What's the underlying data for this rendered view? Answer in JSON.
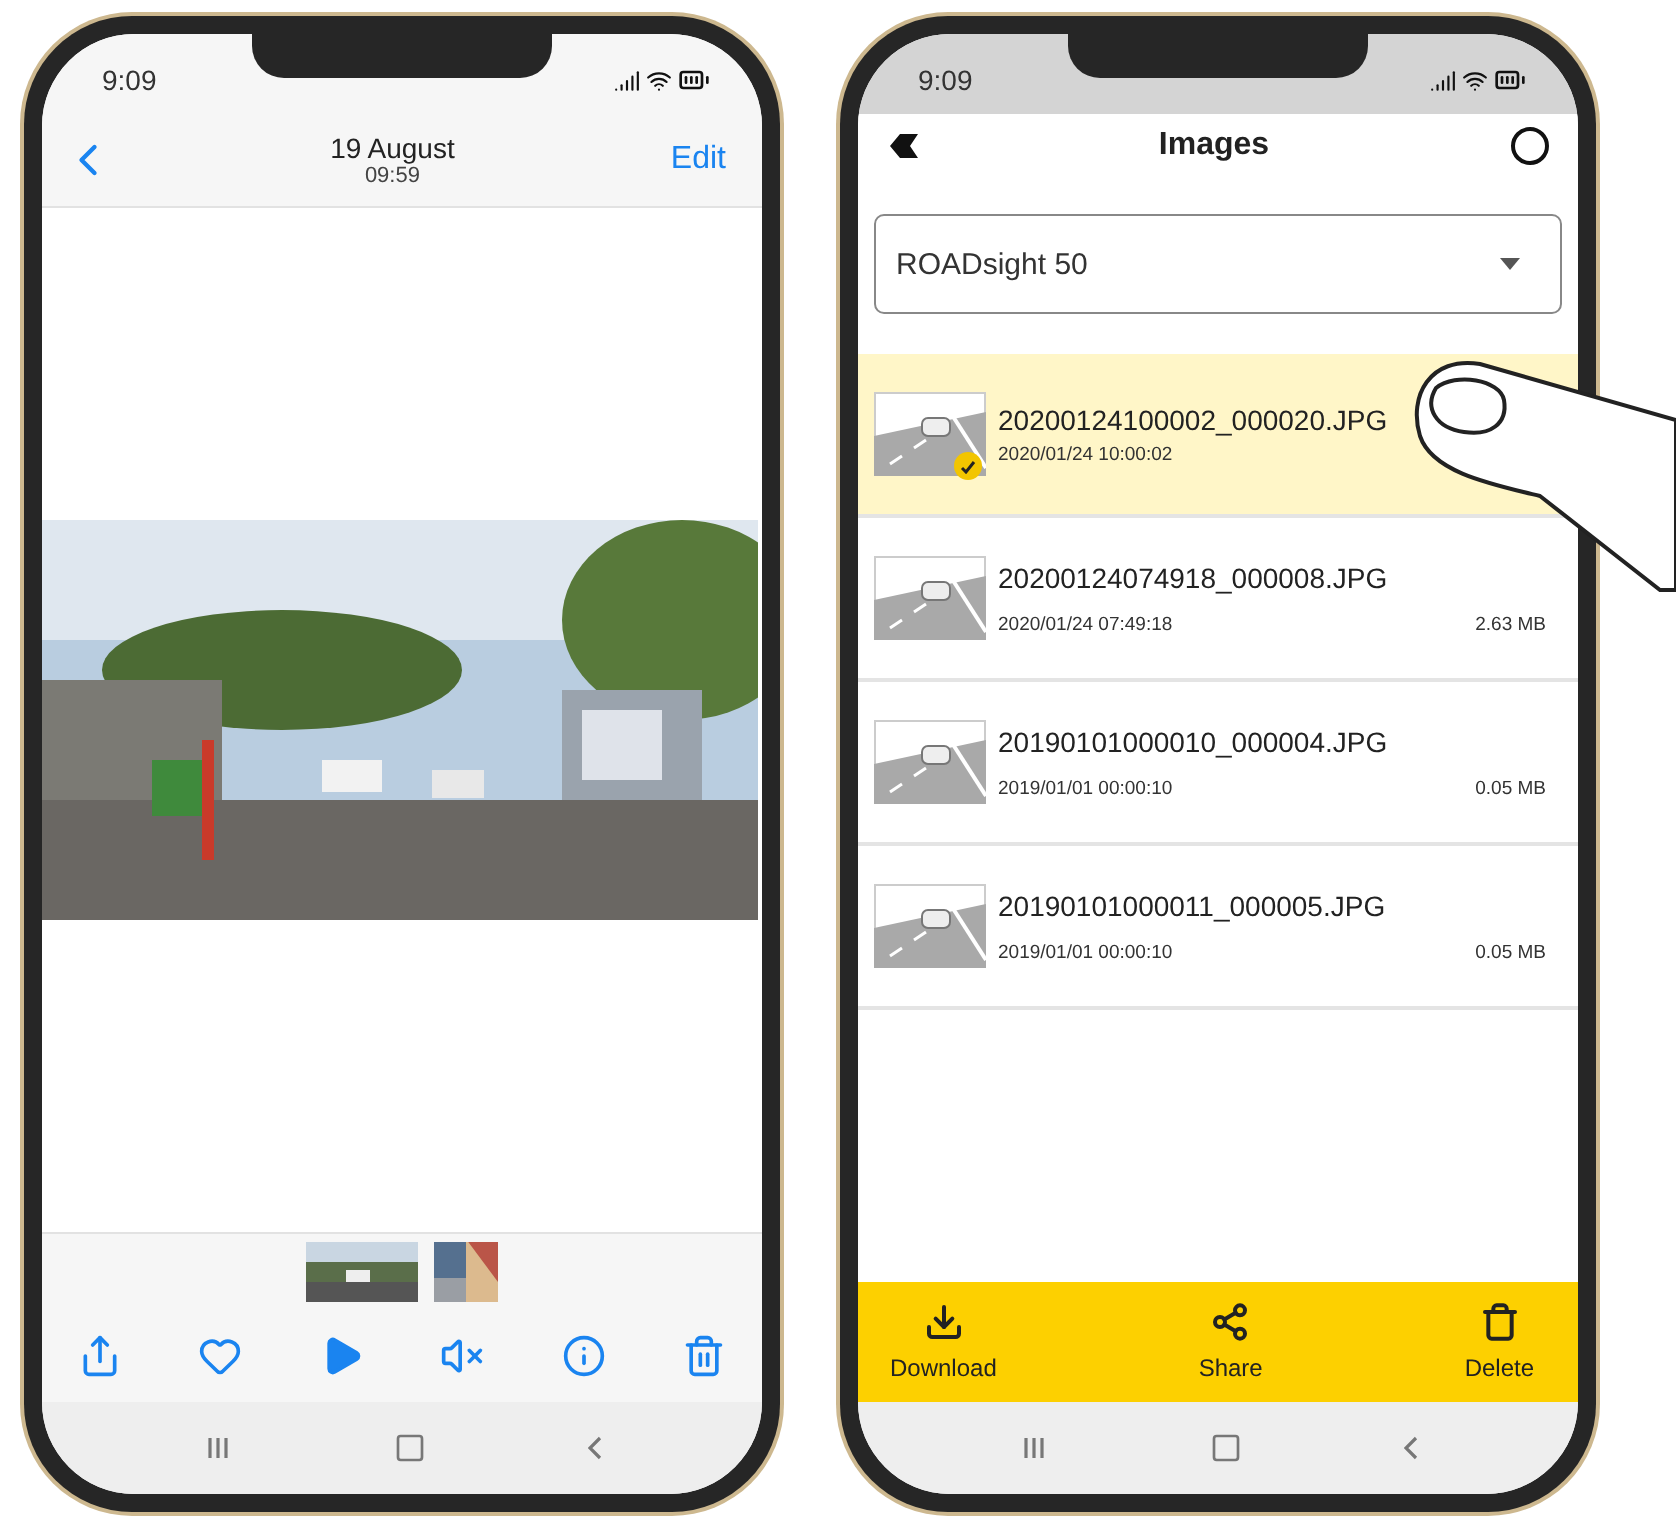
{
  "photo_viewer": {
    "status_bar": {
      "time": "9:09"
    },
    "nav_bar": {
      "title": "19 August",
      "subtitle": "09:59",
      "action": "Edit"
    },
    "photo": {
      "kind": "picture"
    },
    "thumbnails": [
      {
        "kind": "picture",
        "selected": true
      },
      {
        "kind": "picture",
        "selected": false
      }
    ],
    "toolbar": [
      {
        "kind": "share"
      },
      {
        "kind": "heart"
      },
      {
        "kind": "play"
      },
      {
        "kind": "mute"
      },
      {
        "kind": "info"
      },
      {
        "kind": "trash"
      }
    ]
  },
  "images_app": {
    "status_bar": {
      "time": "9:09"
    },
    "title": "Images",
    "dropdown": {
      "value": "ROADsight 50"
    },
    "files": [
      {
        "name": "20200124100002_000020.JPG",
        "date": "2020/01/24 10:00:02",
        "selected": true
      },
      {
        "name": "20200124074918_000008.JPG",
        "date": "2020/01/24 07:49:18",
        "size": "2.63 MB",
        "selected": false
      },
      {
        "name": "20190101000010_000004.JPG",
        "date": "2019/01/01 00:00:10",
        "size": "0.05 MB",
        "selected": false
      },
      {
        "name": "20190101000011_000005.JPG",
        "date": "2019/01/01 00:00:10",
        "size": "0.05 MB",
        "selected": false
      }
    ],
    "actions": [
      {
        "kind": "download",
        "label": "Download"
      },
      {
        "kind": "share",
        "label": "Share"
      },
      {
        "kind": "delete",
        "label": "Delete"
      }
    ]
  }
}
